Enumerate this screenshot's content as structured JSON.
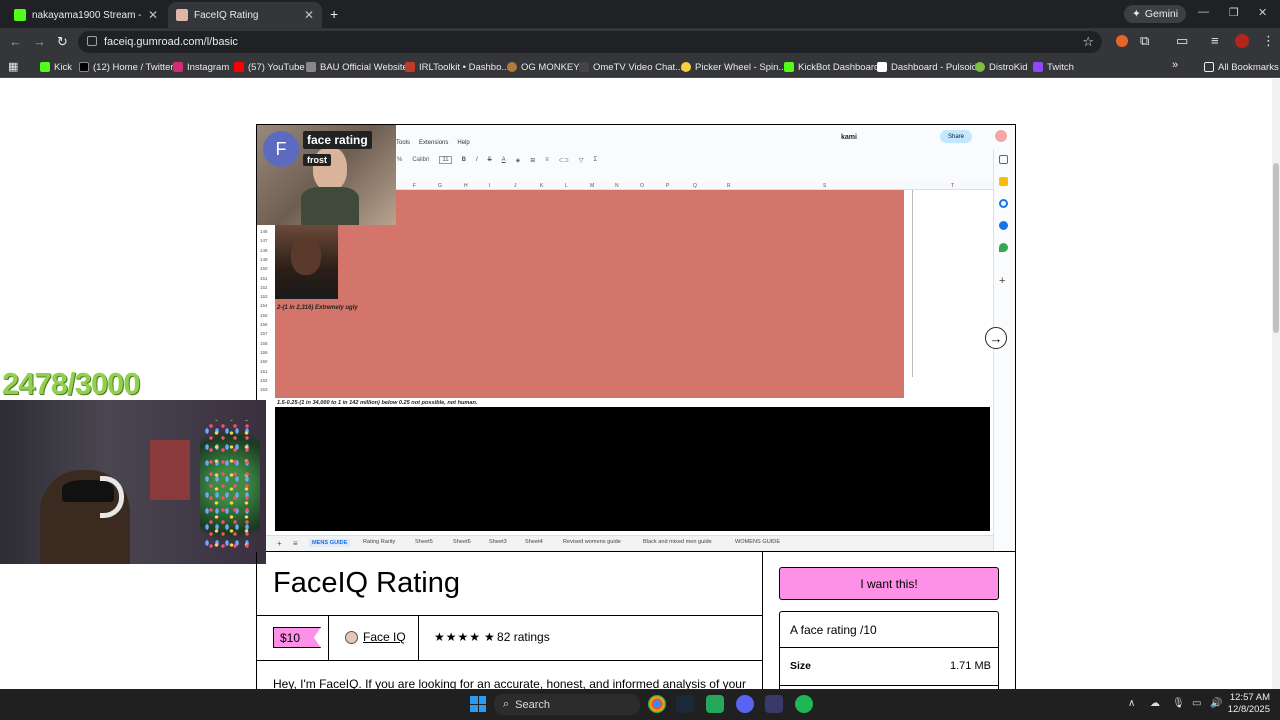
{
  "browser": {
    "tabs": [
      {
        "title": "nakayama1900 Stream - Watch",
        "active": false
      },
      {
        "title": "FaceIQ Rating",
        "active": true
      }
    ],
    "new_tab": "+",
    "gemini_label": "Gemini",
    "url": "faceiq.gumroad.com/l/basic",
    "bookmarks": [
      "Kick",
      "(12) Home / Twitter",
      "Instagram",
      "(57) YouTube",
      "BAU Official Website",
      "IRLToolkit • Dashbo...",
      "OG MONKEY",
      "OmeTV Video Chat...",
      "Picker Wheel - Spin...",
      "KickBot Dashboard",
      "Dashboard - Pulsoid",
      "DistroKid",
      "Twitch"
    ],
    "all_bookmarks": "All Bookmarks"
  },
  "overlay": {
    "counter": "2478/3000",
    "webcam_name": "face rating",
    "webcam_sub": "frost",
    "avatar_letter": "F"
  },
  "sheet": {
    "menu": [
      "Tools",
      "Extensions",
      "Help"
    ],
    "font": "Calibri",
    "font_size": "11",
    "brand": "kami",
    "share": "Share",
    "columns": [
      "F",
      "G",
      "H",
      "I",
      "J",
      "K",
      "L",
      "M",
      "N",
      "O",
      "P",
      "Q",
      "R",
      "S",
      "T"
    ],
    "row_numbers": [
      "146",
      "147",
      "148",
      "149",
      "150",
      "151",
      "152",
      "153",
      "154",
      "155",
      "156",
      "157",
      "158",
      "159",
      "160",
      "161",
      "162",
      "163"
    ],
    "row_text_1": "2-(1 in 2,316) Extremely ugly",
    "row_text_2": "1.5-0.25-(1 in 34,000 to 1 in 142 million) below 0.25 not possible, not human.",
    "sheet_tabs": [
      "MENS GUIDE",
      "Rating Rarity",
      "Sheet5",
      "Sheet6",
      "Sheet3",
      "Sheet4",
      "Revised womens guide",
      "Black and mixed men guide",
      "WOMENS GUIDE"
    ]
  },
  "product": {
    "title": "FaceIQ Rating",
    "price": "$10",
    "seller": "Face IQ",
    "stars": "★★★★",
    "ratings": "82 ratings",
    "description": "Hey, I'm FaceIQ. If you are looking for an accurate, honest, and informed analysis of your",
    "cta": "I want this!",
    "summary": "A face rating /10",
    "size_label": "Size",
    "size_value": "1.71 MB"
  },
  "taskbar": {
    "search": "Search",
    "time": "12:57 AM",
    "date": "12/8/2025"
  },
  "colors": {
    "accent_pink": "#ff90e8",
    "sheet_red": "#d4756c",
    "counter_green": "#8fd14f"
  }
}
